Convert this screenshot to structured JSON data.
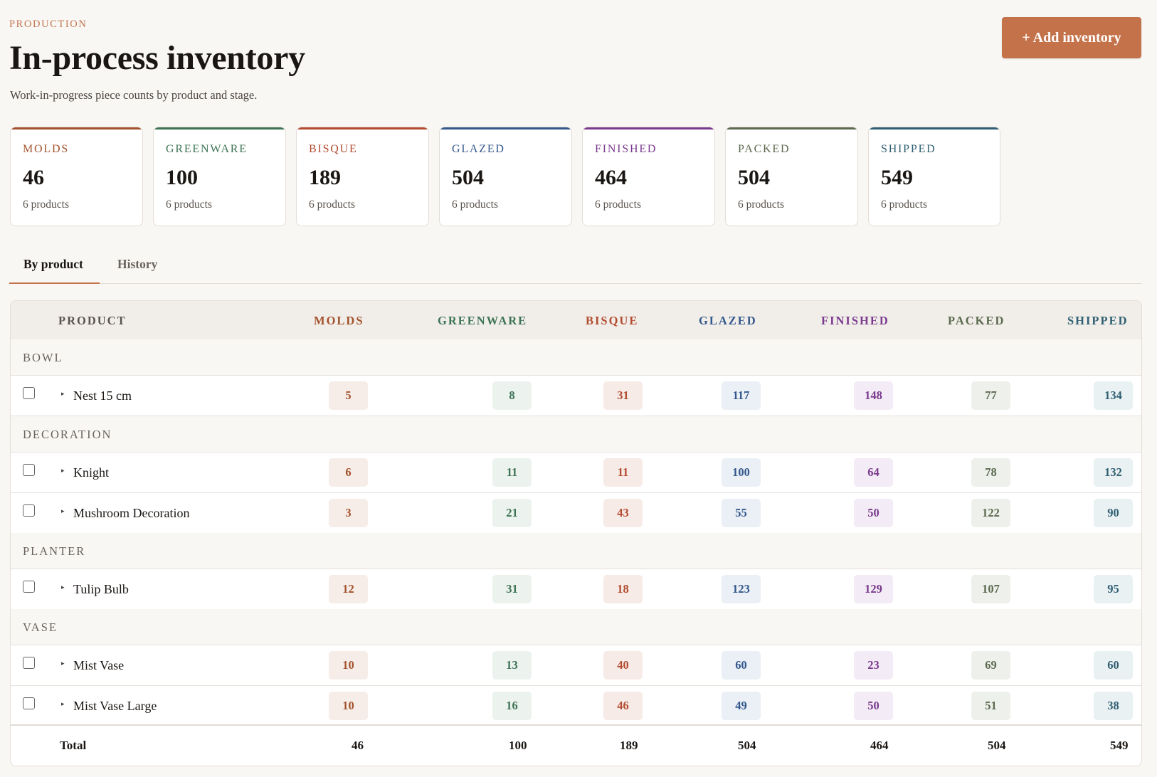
{
  "header": {
    "eyebrow": "PRODUCTION",
    "title": "In-process inventory",
    "subtitle": "Work-in-progress piece counts by product and stage.",
    "add_button": "+ Add inventory"
  },
  "colors": {
    "accent": "#c4724a",
    "molds": "#a3522d",
    "greenware": "#3d7354",
    "bisque": "#b24b2f",
    "glazed": "#33578c",
    "finished": "#7a3a8e",
    "packed": "#5c6a4f",
    "shipped": "#2f5f72"
  },
  "cards": [
    {
      "label": "MOLDS",
      "value": "46",
      "sub": "6 products"
    },
    {
      "label": "GREENWARE",
      "value": "100",
      "sub": "6 products"
    },
    {
      "label": "BISQUE",
      "value": "189",
      "sub": "6 products"
    },
    {
      "label": "GLAZED",
      "value": "504",
      "sub": "6 products"
    },
    {
      "label": "FINISHED",
      "value": "464",
      "sub": "6 products"
    },
    {
      "label": "PACKED",
      "value": "504",
      "sub": "6 products"
    },
    {
      "label": "SHIPPED",
      "value": "549",
      "sub": "6 products"
    }
  ],
  "tabs": [
    {
      "label": "By product",
      "active": true
    },
    {
      "label": "History",
      "active": false
    }
  ],
  "table": {
    "columns": [
      "PRODUCT",
      "MOLDS",
      "GREENWARE",
      "BISQUE",
      "GLAZED",
      "FINISHED",
      "PACKED",
      "SHIPPED"
    ],
    "groups": [
      {
        "name": "BOWL",
        "rows": [
          {
            "product": "Nest 15 cm",
            "values": [
              "5",
              "8",
              "31",
              "117",
              "148",
              "77",
              "134"
            ]
          }
        ]
      },
      {
        "name": "DECORATION",
        "rows": [
          {
            "product": "Knight",
            "values": [
              "6",
              "11",
              "11",
              "100",
              "64",
              "78",
              "132"
            ]
          },
          {
            "product": "Mushroom Decoration",
            "values": [
              "3",
              "21",
              "43",
              "55",
              "50",
              "122",
              "90"
            ]
          }
        ]
      },
      {
        "name": "PLANTER",
        "rows": [
          {
            "product": "Tulip Bulb",
            "values": [
              "12",
              "31",
              "18",
              "123",
              "129",
              "107",
              "95"
            ]
          }
        ]
      },
      {
        "name": "VASE",
        "rows": [
          {
            "product": "Mist Vase",
            "values": [
              "10",
              "13",
              "40",
              "60",
              "23",
              "69",
              "60"
            ]
          },
          {
            "product": "Mist Vase Large",
            "values": [
              "10",
              "16",
              "46",
              "49",
              "50",
              "51",
              "38"
            ]
          }
        ]
      }
    ],
    "total": {
      "label": "Total",
      "values": [
        "46",
        "100",
        "189",
        "504",
        "464",
        "504",
        "549"
      ]
    }
  }
}
